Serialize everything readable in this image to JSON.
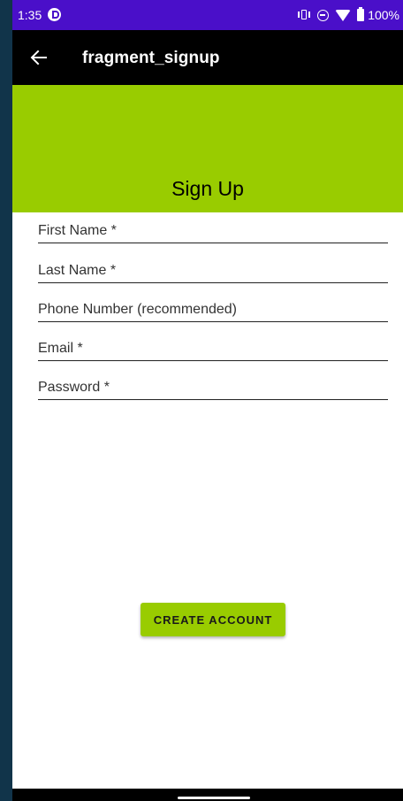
{
  "status_bar": {
    "time": "1:35",
    "battery_text": "100%"
  },
  "app_bar": {
    "title": "fragment_signup"
  },
  "header": {
    "title": "Sign Up"
  },
  "form": {
    "first_name_placeholder": "First Name *",
    "last_name_placeholder": "Last Name *",
    "phone_placeholder": "Phone Number (recommended)",
    "email_placeholder": "Email *",
    "password_placeholder": "Password *"
  },
  "buttons": {
    "create_account": "CREATE ACCOUNT"
  },
  "colors": {
    "status_bar": "#4a0fc9",
    "app_bar": "#000000",
    "accent": "#99cc00"
  }
}
